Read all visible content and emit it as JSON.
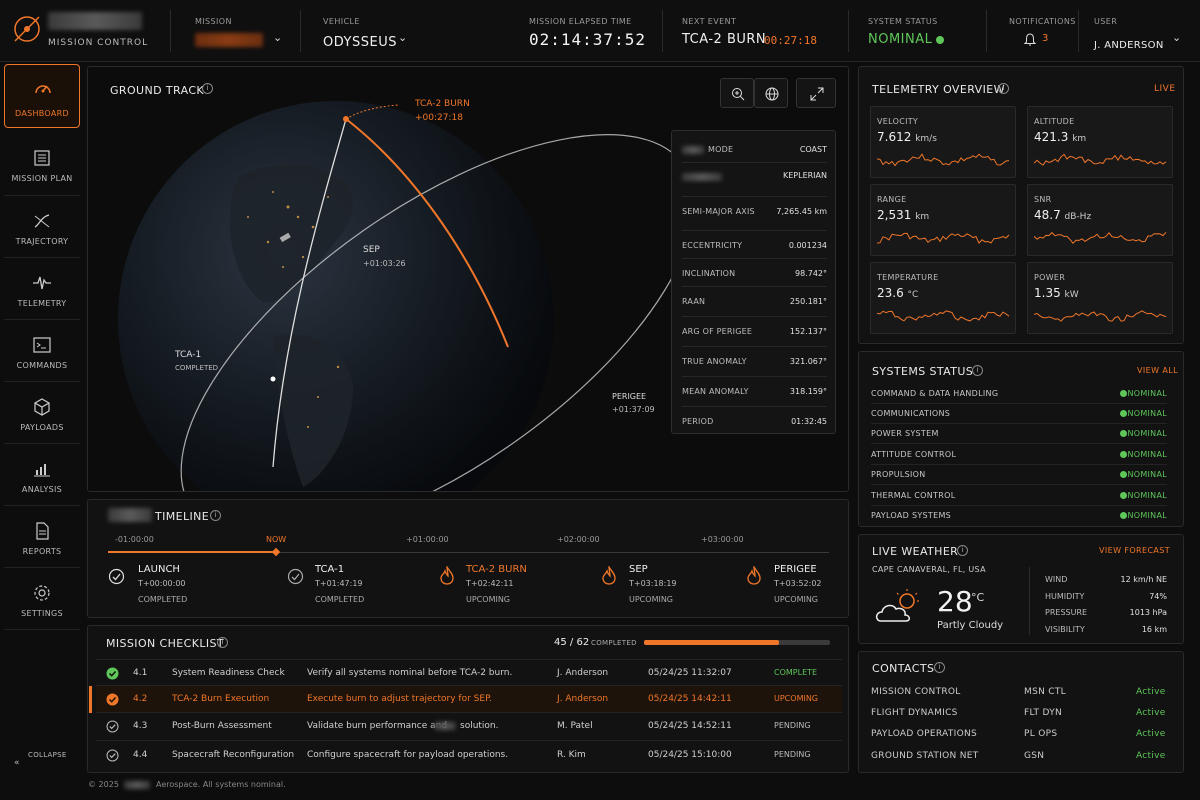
{
  "topbar": {
    "app_subtitle": "MISSION CONTROL",
    "mission_label": "MISSION",
    "vehicle_label": "VEHICLE",
    "vehicle_value": "ODYSSEUS",
    "met_label": "MISSION ELAPSED TIME",
    "met_value": "02:14:37:52",
    "next_event_label": "NEXT EVENT",
    "next_event_name": "TCA-2 BURN",
    "next_event_countdown": "00:27:18",
    "status_label": "SYSTEM STATUS",
    "status_value": "NOMINAL",
    "notifications_label": "NOTIFICATIONS",
    "notifications_count": "3",
    "user_label": "USER",
    "user_value": "J. ANDERSON"
  },
  "sidebar": {
    "items": [
      {
        "label": "DASHBOARD",
        "icon": "gauge-icon"
      },
      {
        "label": "MISSION PLAN",
        "icon": "checklist-icon"
      },
      {
        "label": "TRAJECTORY",
        "icon": "trajectory-icon"
      },
      {
        "label": "TELEMETRY",
        "icon": "pulse-icon"
      },
      {
        "label": "COMMANDS",
        "icon": "terminal-icon"
      },
      {
        "label": "PAYLOADS",
        "icon": "cube-icon"
      },
      {
        "label": "ANALYSIS",
        "icon": "bar-chart-icon"
      },
      {
        "label": "REPORTS",
        "icon": "document-icon"
      },
      {
        "label": "SETTINGS",
        "icon": "gear-icon"
      }
    ],
    "collapse_label": "COLLAPSE"
  },
  "ground_track": {
    "title": "GROUND TRACK",
    "burn_label": "TCA-2 BURN",
    "burn_time": "+00:27:18",
    "sep_label": "SEP",
    "sep_time": "+01:03:26",
    "tca1_label": "TCA-1",
    "tca1_status": "COMPLETED",
    "perigee_label": "PERIGEE",
    "perigee_time": "+01:37:09",
    "orbital": [
      {
        "key": "MODE",
        "value": "COAST"
      },
      {
        "key": "",
        "value": "KEPLERIAN"
      },
      {
        "key": "SEMI-MAJOR AXIS",
        "value": "7,265.45 km"
      },
      {
        "key": "ECCENTRICITY",
        "value": "0.001234"
      },
      {
        "key": "INCLINATION",
        "value": "98.742°"
      },
      {
        "key": "RAAN",
        "value": "250.181°"
      },
      {
        "key": "ARG OF PERIGEE",
        "value": "152.137°"
      },
      {
        "key": "TRUE ANOMALY",
        "value": "321.067°"
      },
      {
        "key": "MEAN ANOMALY",
        "value": "318.159°"
      },
      {
        "key": "PERIOD",
        "value": "01:32:45"
      }
    ]
  },
  "timeline": {
    "title": "TIMELINE",
    "ticks": [
      "-01:00:00",
      "NOW",
      "+01:00:00",
      "+02:00:00",
      "+03:00:00"
    ],
    "events": [
      {
        "name": "LAUNCH",
        "time": "T+00:00:00",
        "status": "COMPLETED"
      },
      {
        "name": "TCA-1",
        "time": "T+01:47:19",
        "status": "COMPLETED"
      },
      {
        "name": "TCA-2 BURN",
        "time": "T+02:42:11",
        "status": "UPCOMING"
      },
      {
        "name": "SEP",
        "time": "T+03:18:19",
        "status": "UPCOMING"
      },
      {
        "name": "PERIGEE",
        "time": "T+03:52:02",
        "status": "UPCOMING"
      }
    ]
  },
  "checklist": {
    "title": "MISSION CHECKLIST",
    "progress_count": "45 / 62",
    "progress_label": "COMPLETED",
    "progress_fraction": 0.726,
    "rows": [
      {
        "id": "4.1",
        "name": "System Readiness Check",
        "desc": "Verify all systems nominal before TCA-2 burn.",
        "owner": "J. Anderson",
        "time": "05/24/25 11:32:07",
        "status": "COMPLETE"
      },
      {
        "id": "4.2",
        "name": "TCA-2 Burn Execution",
        "desc": "Execute burn to adjust trajectory for SEP.",
        "owner": "J. Anderson",
        "time": "05/24/25 14:42:11",
        "status": "UPCOMING"
      },
      {
        "id": "4.3",
        "name": "Post-Burn Assessment",
        "desc": "Validate burn performance and",
        "desc_tail": "solution.",
        "owner": "M. Patel",
        "time": "05/24/25 14:52:11",
        "status": "PENDING"
      },
      {
        "id": "4.4",
        "name": "Spacecraft Reconfiguration",
        "desc": "Configure spacecraft for payload operations.",
        "owner": "R. Kim",
        "time": "05/24/25 15:10:00",
        "status": "PENDING"
      }
    ]
  },
  "telemetry": {
    "title": "TELEMETRY OVERVIEW",
    "live_label": "LIVE",
    "tiles": [
      {
        "label": "VELOCITY",
        "value": "7.612",
        "unit": "km/s"
      },
      {
        "label": "ALTITUDE",
        "value": "421.3",
        "unit": "km"
      },
      {
        "label": "RANGE",
        "value": "2,531",
        "unit": "km"
      },
      {
        "label": "SNR",
        "value": "48.7",
        "unit": "dB-Hz"
      },
      {
        "label": "TEMPERATURE",
        "value": "23.6",
        "unit": "°C"
      },
      {
        "label": "POWER",
        "value": "1.35",
        "unit": "kW"
      }
    ]
  },
  "systems": {
    "title": "SYSTEMS STATUS",
    "view_all": "VIEW ALL",
    "rows": [
      {
        "name": "COMMAND & DATA HANDLING",
        "status": "NOMINAL"
      },
      {
        "name": "COMMUNICATIONS",
        "status": "NOMINAL"
      },
      {
        "name": "POWER SYSTEM",
        "status": "NOMINAL"
      },
      {
        "name": "ATTITUDE CONTROL",
        "status": "NOMINAL"
      },
      {
        "name": "PROPULSION",
        "status": "NOMINAL"
      },
      {
        "name": "THERMAL CONTROL",
        "status": "NOMINAL"
      },
      {
        "name": "PAYLOAD SYSTEMS",
        "status": "NOMINAL"
      }
    ]
  },
  "weather": {
    "title": "LIVE WEATHER",
    "forecast_link": "VIEW FORECAST",
    "location": "CAPE CANAVERAL, FL, USA",
    "temp": "28",
    "temp_unit": "°C",
    "condition": "Partly Cloudy",
    "stats": [
      {
        "key": "WIND",
        "value": "12 km/h NE"
      },
      {
        "key": "HUMIDITY",
        "value": "74%"
      },
      {
        "key": "PRESSURE",
        "value": "1013 hPa"
      },
      {
        "key": "VISIBILITY",
        "value": "16 km"
      }
    ]
  },
  "contacts": {
    "title": "CONTACTS",
    "rows": [
      {
        "name": "MISSION CONTROL",
        "call": "MSN CTL",
        "status": "Active"
      },
      {
        "name": "FLIGHT DYNAMICS",
        "call": "FLT DYN",
        "status": "Active"
      },
      {
        "name": "PAYLOAD OPERATIONS",
        "call": "PL OPS",
        "status": "Active"
      },
      {
        "name": "GROUND STATION NET",
        "call": "GSN",
        "status": "Active"
      }
    ]
  },
  "footer": {
    "copyright": "© 2025",
    "text": "Aerospace. All systems nominal."
  },
  "colors": {
    "accent": "#f0762a",
    "nominal": "#5fc65a",
    "background": "#0d0d0d"
  }
}
